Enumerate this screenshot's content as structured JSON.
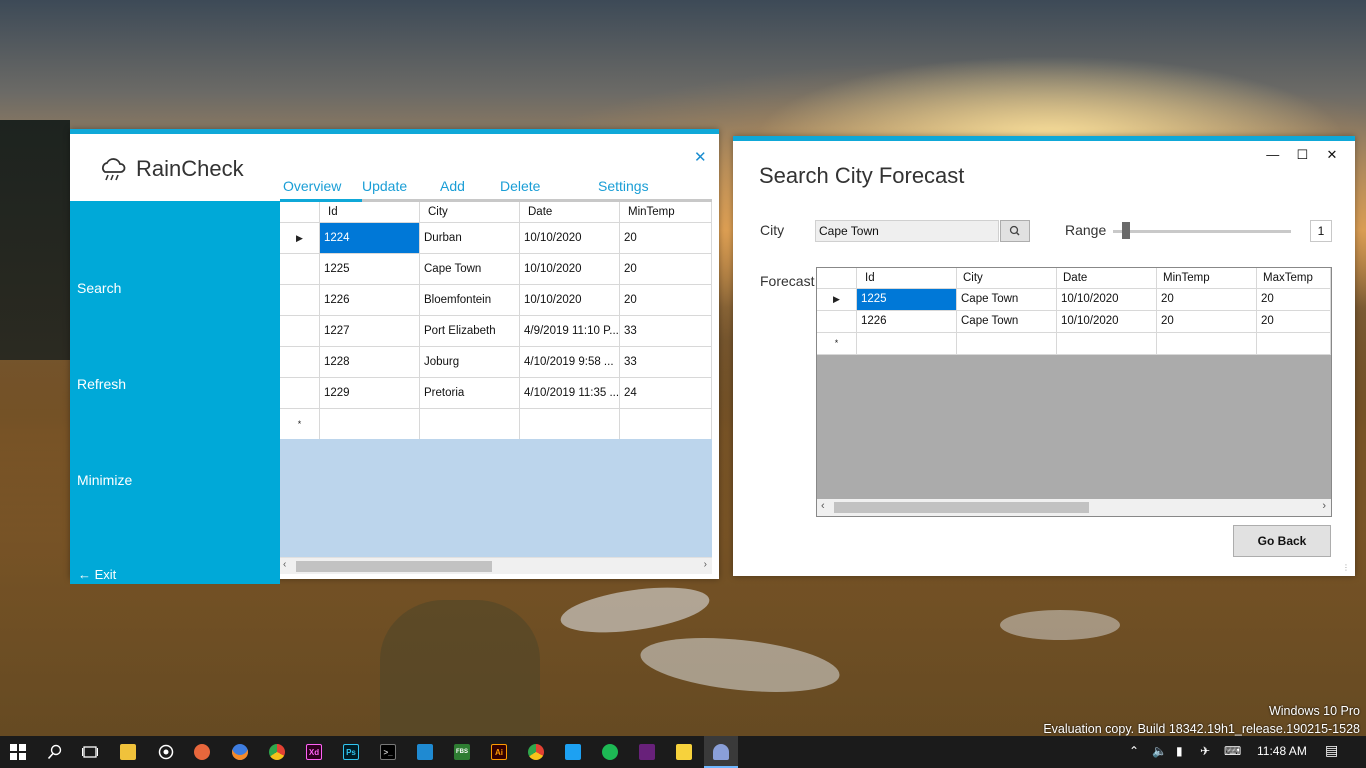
{
  "rain_check": {
    "title": "RainCheck",
    "close": "✕",
    "nav": [
      "Overview",
      "Update",
      "Add",
      "Delete",
      "Settings"
    ],
    "sidebar": [
      "Search",
      "Refresh",
      "Minimize"
    ],
    "exit": "Exit",
    "columns": [
      "Id",
      "City",
      "Date",
      "MinTemp"
    ],
    "rows": [
      [
        "1224",
        "Durban",
        "10/10/2020",
        "20"
      ],
      [
        "1225",
        "Cape Town",
        "10/10/2020",
        "20"
      ],
      [
        "1226",
        "Bloemfontein",
        "10/10/2020",
        "20"
      ],
      [
        "1227",
        "Port Elizabeth",
        "4/9/2019 11:10 P...",
        "33"
      ],
      [
        "1228",
        "Joburg",
        "4/10/2019 9:58 ...",
        "33"
      ],
      [
        "1229",
        "Pretoria",
        "4/10/2019 11:35 ...",
        "24"
      ]
    ],
    "new_row_marker": "*",
    "selected_marker": "▶"
  },
  "search_window": {
    "title": "Search City Forecast",
    "city_label": "City",
    "city_value": "Cape Town",
    "range_label": "Range",
    "range_value": "1",
    "forecast_label": "Forecast",
    "columns": [
      "Id",
      "City",
      "Date",
      "MinTemp",
      "MaxTemp"
    ],
    "rows": [
      [
        "1225",
        "Cape Town",
        "10/10/2020",
        "20",
        "20"
      ],
      [
        "1226",
        "Cape Town",
        "10/10/2020",
        "20",
        "20"
      ]
    ],
    "new_row_marker": "*",
    "selected_marker": "▶",
    "go_back": "Go Back",
    "controls": [
      "—",
      "☐",
      "✕"
    ]
  },
  "watermark": {
    "line1": "Windows 10 Pro",
    "line2": "Evaluation copy. Build 18342.19h1_release.190215-1528"
  },
  "taskbar": {
    "time": "11:48 AM",
    "apps": [
      "Xd",
      "Ps",
      "FBS",
      "Ai"
    ]
  },
  "colors": {
    "accent": "#00a9d8",
    "selection": "#0078d7",
    "grid_empty": "#bcd5ec"
  }
}
